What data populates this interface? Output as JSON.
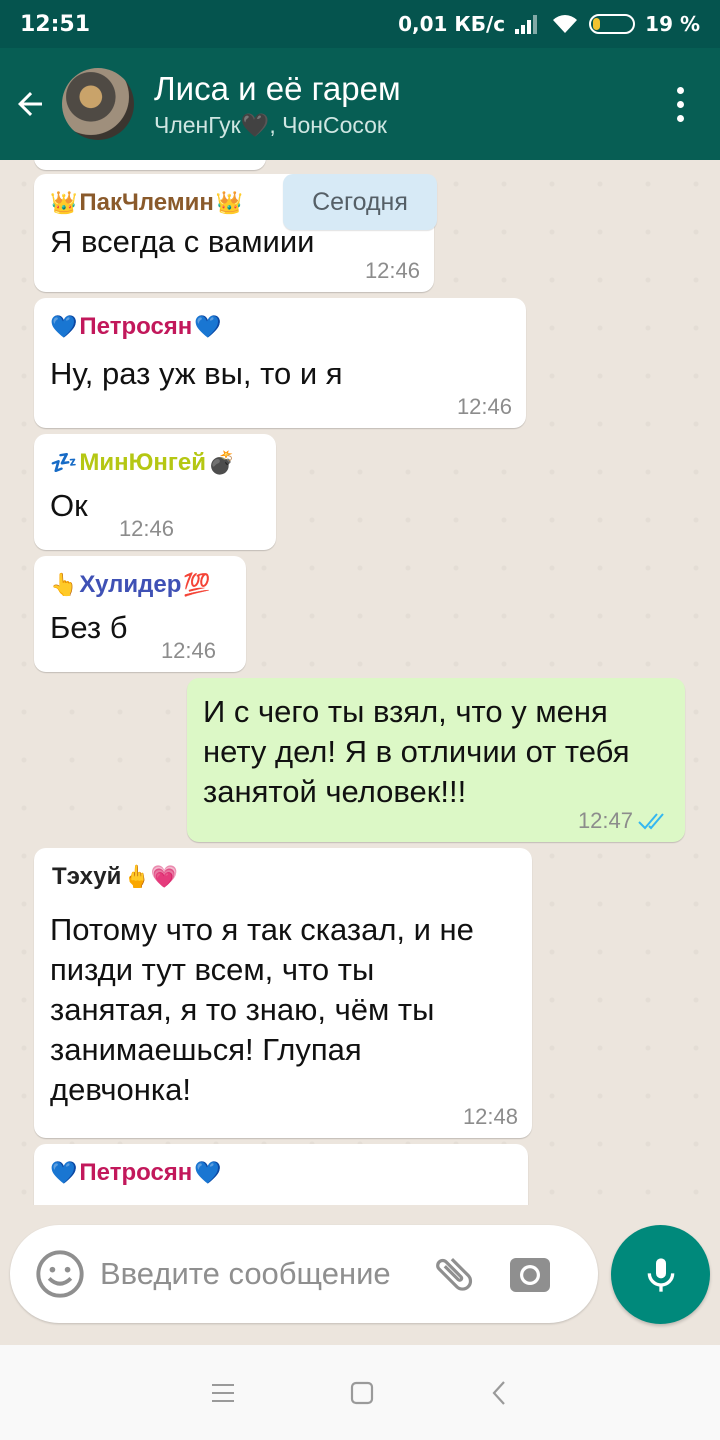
{
  "status_bar": {
    "time": "12:51",
    "network_speed": "0,01 КБ/с",
    "battery_percent": "19 %",
    "battery_level": 0.19
  },
  "header": {
    "title": "Лиса и её гарем",
    "subtitle": "ЧленГук🖤, ЧонСосок"
  },
  "date_chip": "Сегодня",
  "messages": [
    {
      "sender": "ПакЧлемин",
      "sender_color": "#8a5a2b",
      "prefix": "👑",
      "suffix": "👑",
      "text": "Я всегда с вамиии",
      "time": "12:46"
    },
    {
      "sender": "Петросян",
      "sender_color": "#c2185b",
      "prefix": "💙",
      "suffix": "💙",
      "text": "Ну, раз уж вы, то и я",
      "time": "12:46"
    },
    {
      "sender": "МинЮнгей",
      "sender_color": "#b5c713",
      "prefix": "💤",
      "suffix": "💣",
      "text": "Ок",
      "time": "12:46"
    },
    {
      "sender": "Хулидер",
      "sender_color": "#3f51b5",
      "prefix": "👆",
      "suffix": "💯",
      "text": "Без б",
      "time": "12:46"
    },
    {
      "outgoing": true,
      "text": "И с чего ты взял, что у меня нету дел! Я в отличии от тебя занятой человек!!!",
      "time": "12:47"
    },
    {
      "sender": "Тэхуй",
      "sender_color": "#222222",
      "prefix": "",
      "suffix": "🖕💗",
      "text": "Потому что я так сказал, и не пизди тут всем, что ты занятая, я то знаю, чём ты занимаешься! Глупая девчонка!",
      "time": "12:48"
    },
    {
      "sender": "Петросян",
      "sender_color": "#c2185b",
      "prefix": "💙",
      "suffix": "💙"
    }
  ],
  "input": {
    "placeholder": "Введите сообщение"
  },
  "colors": {
    "primary": "#075e54",
    "accent": "#00897b",
    "outgoing_bubble": "#dcf8c6",
    "read_ticks": "#34b7f1"
  },
  "icons": [
    "back-arrow-icon",
    "more-vert-icon",
    "emoji-icon",
    "attach-icon",
    "camera-icon",
    "mic-icon",
    "double-check-icon",
    "menu-lines-icon",
    "square-icon",
    "back-triangle-icon"
  ]
}
